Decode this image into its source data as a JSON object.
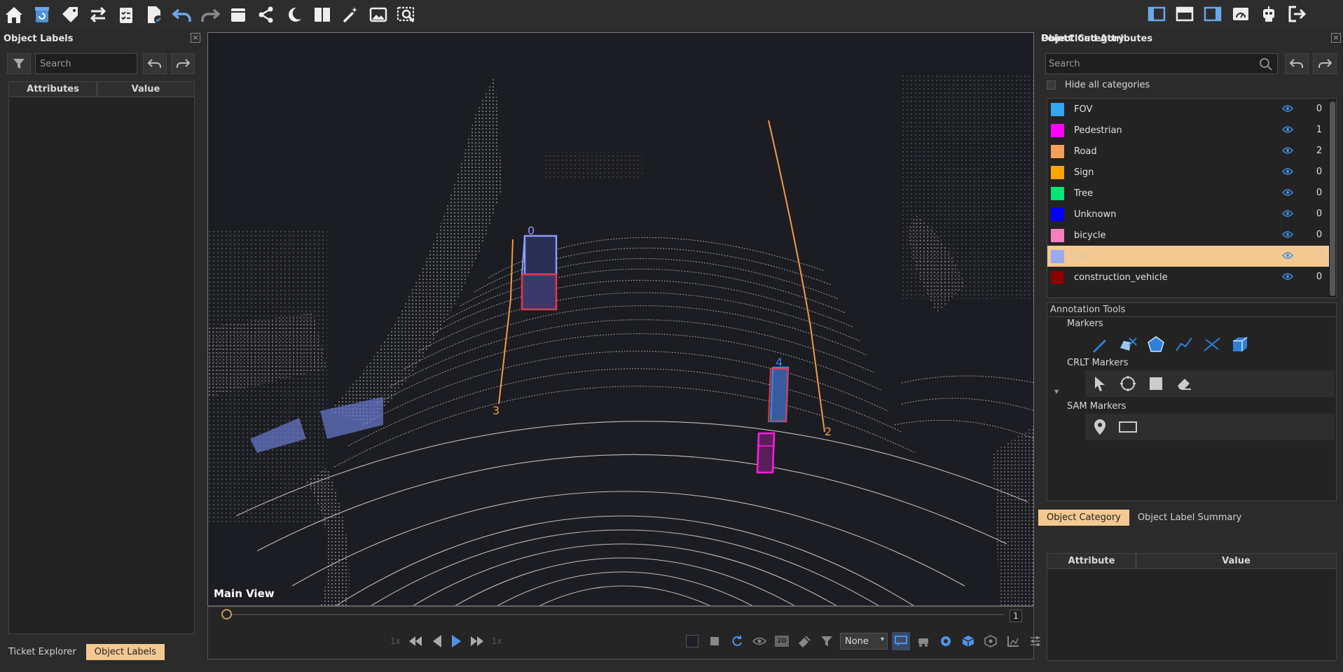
{
  "toolbar": {
    "left_icons": [
      "home-icon",
      "refresh-icon",
      "tag-icon",
      "swap-icon",
      "checklist-icon",
      "file-check-icon",
      "undo-icon",
      "redo-icon",
      "window-icon",
      "share-icon",
      "night-mode-icon",
      "split-view-icon",
      "magic-wand-icon",
      "image-icon",
      "image-search-icon"
    ],
    "right_icons": [
      "layout-left-icon",
      "layout-top-icon",
      "layout-right-icon",
      "dashboard-icon",
      "robot-icon",
      "logout-icon"
    ]
  },
  "left_panel": {
    "title": "Object Labels",
    "search_placeholder": "Search",
    "table": {
      "col_attributes": "Attributes",
      "col_value": "Value"
    },
    "tabs": [
      "Ticket Explorer",
      "Object Labels"
    ],
    "active_tab": "Object Labels"
  },
  "main_view": {
    "label": "Main View",
    "box_labels": [
      "0",
      "4"
    ],
    "line_labels": [
      "3",
      "2"
    ],
    "frame": "1",
    "speed_left": "1x",
    "speed_right": "1x",
    "filter_select": "None"
  },
  "right_panel": {
    "title": "Object Category",
    "search_placeholder": "Search",
    "hide_all_label": "Hide all categories",
    "categories": [
      {
        "name": "FOV",
        "color": "#33a6f4",
        "count": "0"
      },
      {
        "name": "Pedestrian",
        "color": "#ff00ff",
        "count": "1"
      },
      {
        "name": "Road",
        "color": "#f5a05a",
        "count": "2"
      },
      {
        "name": "Sign",
        "color": "#ffa500",
        "count": "0"
      },
      {
        "name": "Tree",
        "color": "#00e676",
        "count": "0"
      },
      {
        "name": "Unknown",
        "color": "#0000ff",
        "count": "0"
      },
      {
        "name": "bicycle",
        "color": "#f77fbe",
        "count": "0"
      },
      {
        "name": "car",
        "color": "#9aaaf7",
        "count": "3",
        "selected": true
      },
      {
        "name": "construction_vehicle",
        "color": "#8b0000",
        "count": "0"
      }
    ],
    "tools": {
      "title": "Annotation Tools",
      "markers_label": "Markers",
      "crlt_label": "CRLT Markers",
      "sam_label": "SAM Markers"
    },
    "tabs": [
      "Object Category",
      "Object Label Summary"
    ],
    "active_tab": "Object Category",
    "pointcloud": {
      "title": "PointCloud Attributes",
      "col_attribute": "Attribute",
      "col_value": "Value"
    }
  }
}
